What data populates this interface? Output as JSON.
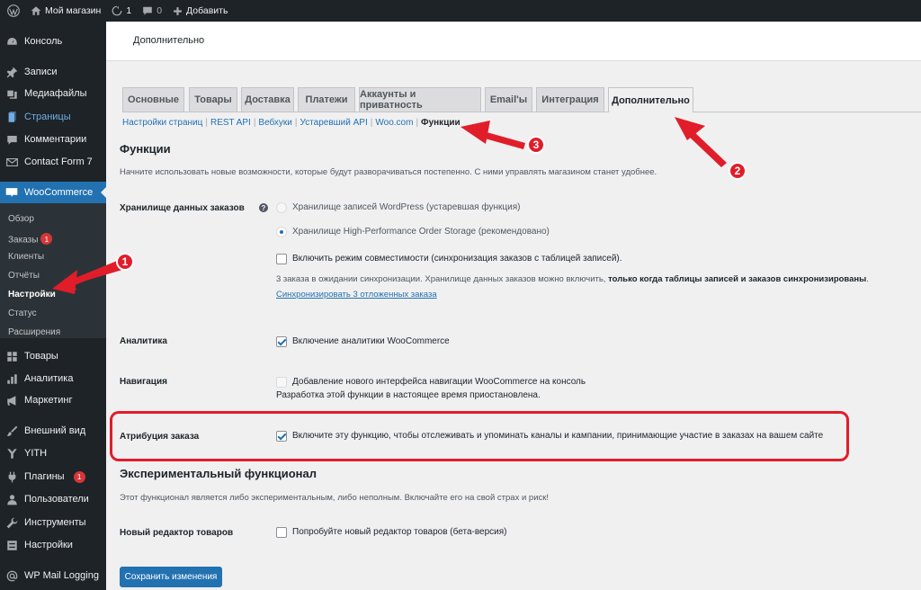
{
  "adminbar": {
    "site_name": "Мой магазин",
    "updates_count": "1",
    "comments_count": "0",
    "add_new": "Добавить"
  },
  "sidebar": {
    "items": [
      {
        "label": "Консоль",
        "icon": "dashboard-icon"
      },
      {
        "label": "Записи",
        "icon": "pin-icon"
      },
      {
        "label": "Медиафайлы",
        "icon": "media-icon"
      },
      {
        "label": "Страницы",
        "icon": "pages-icon"
      },
      {
        "label": "Комментарии",
        "icon": "comment-icon"
      },
      {
        "label": "Contact Form 7",
        "icon": "mail-icon"
      },
      {
        "label": "WooCommerce",
        "icon": "woo-icon"
      },
      {
        "label": "Товары",
        "icon": "products-icon"
      },
      {
        "label": "Аналитика",
        "icon": "analytics-icon"
      },
      {
        "label": "Маркетинг",
        "icon": "megaphone-icon"
      },
      {
        "label": "Внешний вид",
        "icon": "brush-icon"
      },
      {
        "label": "YITH",
        "icon": "yith-icon"
      },
      {
        "label": "Плагины",
        "icon": "plugin-icon",
        "badge": "1"
      },
      {
        "label": "Пользователи",
        "icon": "users-icon"
      },
      {
        "label": "Инструменты",
        "icon": "wrench-icon"
      },
      {
        "label": "Настройки",
        "icon": "settings-icon"
      },
      {
        "label": "WP Mail Logging",
        "icon": "at-icon"
      }
    ],
    "submenu": [
      {
        "label": "Обзор"
      },
      {
        "label": "Заказы",
        "badge": "1"
      },
      {
        "label": "Клиенты"
      },
      {
        "label": "Отчёты"
      },
      {
        "label": "Настройки"
      },
      {
        "label": "Статус"
      },
      {
        "label": "Расширения"
      }
    ]
  },
  "header": {
    "title": "Дополнительно"
  },
  "tabs": [
    "Основные",
    "Товары",
    "Доставка",
    "Платежи",
    "Аккаунты и приватность",
    "Email'ы",
    "Интеграция",
    "Дополнительно"
  ],
  "subnav": [
    "Настройки страниц",
    "REST API",
    "Вебхуки",
    "Устаревший API",
    "Woo.com",
    "Функции"
  ],
  "features": {
    "title": "Функции",
    "description": "Начните использовать новые возможности, которые будут разворачиваться постепенно. С ними управлять магазином станет удобнее.",
    "storage_label": "Хранилище данных заказов",
    "storage_opt1": "Хранилище записей WordPress (устаревшая функция)",
    "storage_opt2": "Хранилище High-Performance Order Storage (рекомендовано)",
    "compat_label": "Включить режим совместимости (синхронизация заказов с таблицей записей).",
    "sync_info": "3 заказа в ожидании синхронизации. Хранилище данных заказов можно включить, ",
    "sync_info_bold": "только когда таблицы записей и заказов синхронизированы",
    "sync_link": "Синхронизировать 3 отложенных заказа",
    "analytics_label": "Аналитика",
    "analytics_opt": "Включение аналитики WooCommerce",
    "navigation_label": "Навигация",
    "navigation_opt": "Добавление нового интерфейса навигации WooCommerce на консоль",
    "navigation_note": "Разработка этой функции в настоящее время приостановлена.",
    "attribution_label": "Атрибуция заказа",
    "attribution_opt": "Включите эту функцию, чтобы отслеживать и упоминать каналы и кампании, принимающие участие в заказах на вашем сайте"
  },
  "experimental": {
    "title": "Экспериментальный функционал",
    "description": "Этот функционал является либо экспериментальным, либо неполным. Включайте его на свой страх и риск!",
    "editor_label": "Новый редактор товаров",
    "editor_opt": "Попробуйте новый редактор товаров (бета-версия)"
  },
  "save_button": "Сохранить изменения",
  "annotations": {
    "m1": "1",
    "m2": "2",
    "m3": "3",
    "color": "#e11d2a"
  },
  "colors": {
    "accent": "#2271b1",
    "sidebar": "#1d2327",
    "badge": "#d63638"
  }
}
